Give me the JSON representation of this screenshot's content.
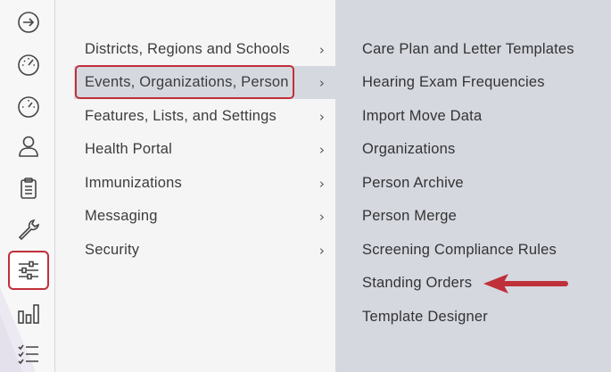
{
  "rail": {
    "icons": [
      {
        "name": "arrow-circle-right-icon"
      },
      {
        "name": "gauge-icon"
      },
      {
        "name": "dashboard-gauge-icon"
      },
      {
        "name": "person-icon"
      },
      {
        "name": "clipboard-icon"
      },
      {
        "name": "wrench-icon"
      },
      {
        "name": "sliders-icon",
        "active": true
      },
      {
        "name": "bar-chart-icon"
      },
      {
        "name": "checklist-icon"
      }
    ],
    "active_border_color": "#c0303a"
  },
  "menu": {
    "items": [
      {
        "label": "Districts, Regions and Schools"
      },
      {
        "label": "Events, Organizations, Person",
        "selected": true
      },
      {
        "label": "Features, Lists, and Settings"
      },
      {
        "label": "Health Portal"
      },
      {
        "label": "Immunizations"
      },
      {
        "label": "Messaging"
      },
      {
        "label": "Security"
      }
    ],
    "chevron": "›"
  },
  "submenu": {
    "items": [
      {
        "label": "Care Plan and Letter Templates"
      },
      {
        "label": "Hearing Exam Frequencies"
      },
      {
        "label": "Import Move Data"
      },
      {
        "label": "Organizations"
      },
      {
        "label": "Person Archive"
      },
      {
        "label": "Person Merge"
      },
      {
        "label": "Screening Compliance Rules"
      },
      {
        "label": "Standing Orders",
        "pointed_at": true
      },
      {
        "label": "Template Designer"
      }
    ]
  },
  "colors": {
    "annotation_red": "#c0303a",
    "submenu_bg": "#d6d8e0",
    "menu_bg": "#f5f5f6"
  }
}
